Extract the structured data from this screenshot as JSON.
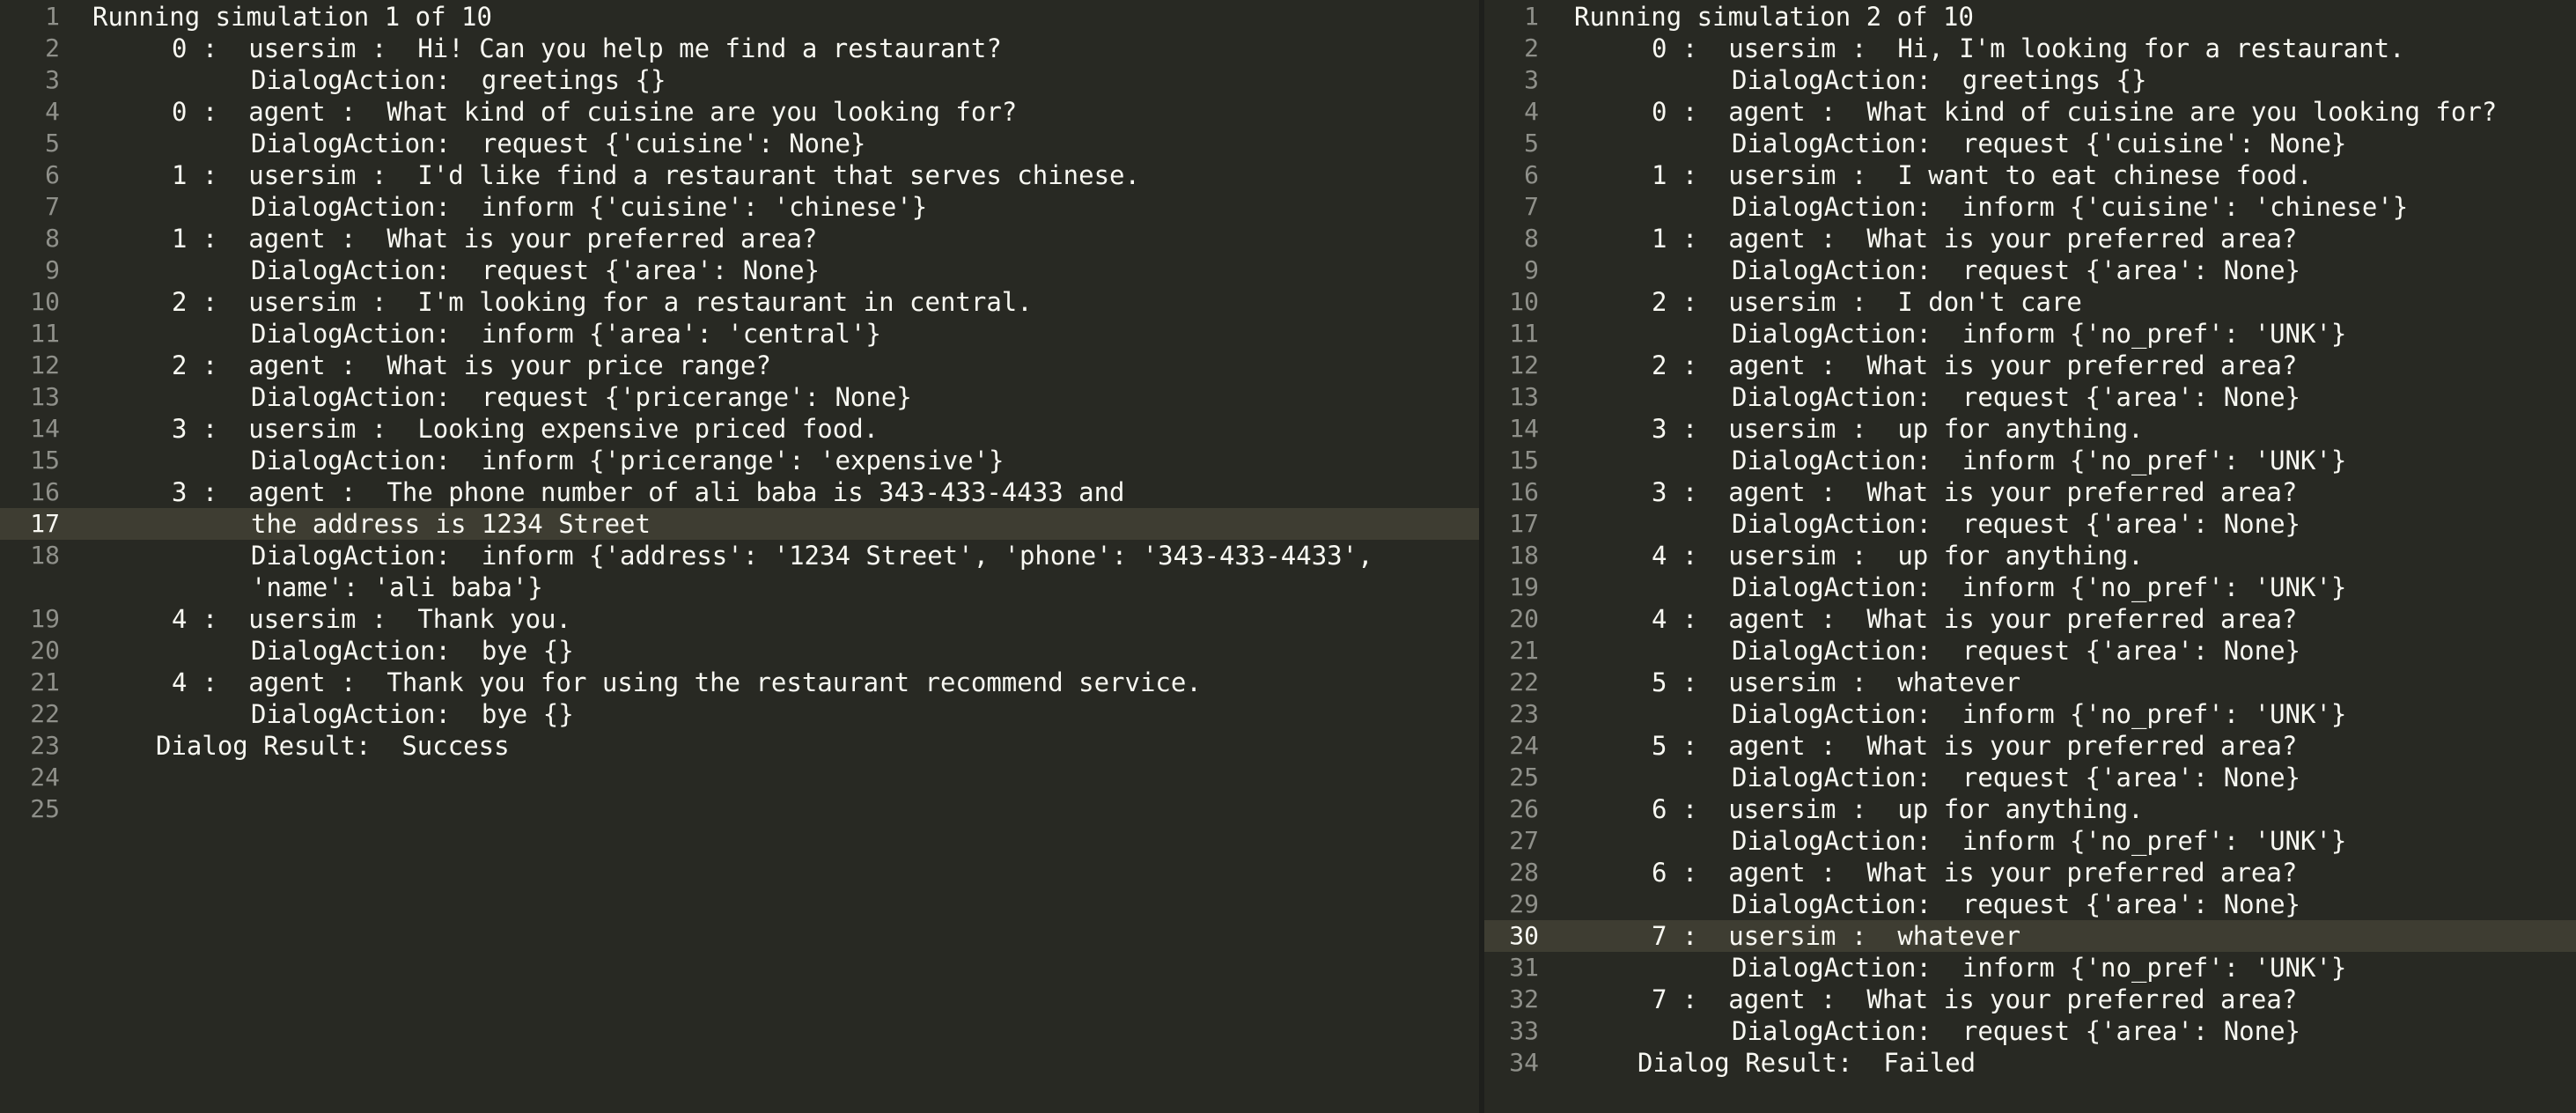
{
  "left_pane": {
    "lines": [
      {
        "num": "1",
        "text": "Running simulation 1 of 10",
        "indent": 0
      },
      {
        "num": "2",
        "text": "0 :  usersim :  Hi! Can you help me find a restaurant?",
        "indent": 1
      },
      {
        "num": "3",
        "text": "DialogAction:  greetings {}",
        "indent": 2
      },
      {
        "num": "4",
        "text": "0 :  agent :  What kind of cuisine are you looking for?",
        "indent": 1
      },
      {
        "num": "5",
        "text": "DialogAction:  request {'cuisine': None}",
        "indent": 2
      },
      {
        "num": "6",
        "text": "1 :  usersim :  I'd like find a restaurant that serves chinese.",
        "indent": 1
      },
      {
        "num": "7",
        "text": "DialogAction:  inform {'cuisine': 'chinese'}",
        "indent": 2
      },
      {
        "num": "8",
        "text": "1 :  agent :  What is your preferred area?",
        "indent": 1
      },
      {
        "num": "9",
        "text": "DialogAction:  request {'area': None}",
        "indent": 2
      },
      {
        "num": "10",
        "text": "2 :  usersim :  I'm looking for a restaurant in central.",
        "indent": 1
      },
      {
        "num": "11",
        "text": "DialogAction:  inform {'area': 'central'}",
        "indent": 2
      },
      {
        "num": "12",
        "text": "2 :  agent :  What is your price range?",
        "indent": 1
      },
      {
        "num": "13",
        "text": "DialogAction:  request {'pricerange': None}",
        "indent": 2
      },
      {
        "num": "14",
        "text": "3 :  usersim :  Looking expensive priced food.",
        "indent": 1
      },
      {
        "num": "15",
        "text": "DialogAction:  inform {'pricerange': 'expensive'}",
        "indent": 2
      },
      {
        "num": "16",
        "text": "3 :  agent :  The phone number of ali baba is 343-433-4433 and",
        "indent": 1
      },
      {
        "num": "17",
        "text": "the address is 1234 Street",
        "indent": 2,
        "current": true
      },
      {
        "num": "18",
        "text": "DialogAction:  inform {'address': '1234 Street', 'phone': '343-433-4433',",
        "indent": 2
      },
      {
        "num": "",
        "text": "'name': 'ali baba'}",
        "indent": 2
      },
      {
        "num": "19",
        "text": "4 :  usersim :  Thank you.",
        "indent": 1
      },
      {
        "num": "20",
        "text": "DialogAction:  bye {}",
        "indent": 2
      },
      {
        "num": "21",
        "text": "4 :  agent :  Thank you for using the restaurant recommend service.",
        "indent": 1
      },
      {
        "num": "22",
        "text": "DialogAction:  bye {}",
        "indent": 2
      },
      {
        "num": "23",
        "text": "Dialog Result:  Success",
        "indent": 3
      },
      {
        "num": "24",
        "text": "",
        "indent": 0
      },
      {
        "num": "25",
        "text": "",
        "indent": 0
      }
    ]
  },
  "right_pane": {
    "lines": [
      {
        "num": "1",
        "text": "Running simulation 2 of 10",
        "indent": 0
      },
      {
        "num": "2",
        "text": "0 :  usersim :  Hi, I'm looking for a restaurant.",
        "indent": 1
      },
      {
        "num": "3",
        "text": "DialogAction:  greetings {}",
        "indent": 2
      },
      {
        "num": "4",
        "text": "0 :  agent :  What kind of cuisine are you looking for?",
        "indent": 1
      },
      {
        "num": "5",
        "text": "DialogAction:  request {'cuisine': None}",
        "indent": 2
      },
      {
        "num": "6",
        "text": "1 :  usersim :  I want to eat chinese food.",
        "indent": 1
      },
      {
        "num": "7",
        "text": "DialogAction:  inform {'cuisine': 'chinese'}",
        "indent": 2
      },
      {
        "num": "8",
        "text": "1 :  agent :  What is your preferred area?",
        "indent": 1
      },
      {
        "num": "9",
        "text": "DialogAction:  request {'area': None}",
        "indent": 2
      },
      {
        "num": "10",
        "text": "2 :  usersim :  I don't care",
        "indent": 1
      },
      {
        "num": "11",
        "text": "DialogAction:  inform {'no_pref': 'UNK'}",
        "indent": 2
      },
      {
        "num": "12",
        "text": "2 :  agent :  What is your preferred area?",
        "indent": 1
      },
      {
        "num": "13",
        "text": "DialogAction:  request {'area': None}",
        "indent": 2
      },
      {
        "num": "14",
        "text": "3 :  usersim :  up for anything.",
        "indent": 1
      },
      {
        "num": "15",
        "text": "DialogAction:  inform {'no_pref': 'UNK'}",
        "indent": 2
      },
      {
        "num": "16",
        "text": "3 :  agent :  What is your preferred area?",
        "indent": 1
      },
      {
        "num": "17",
        "text": "DialogAction:  request {'area': None}",
        "indent": 2
      },
      {
        "num": "18",
        "text": "4 :  usersim :  up for anything.",
        "indent": 1
      },
      {
        "num": "19",
        "text": "DialogAction:  inform {'no_pref': 'UNK'}",
        "indent": 2
      },
      {
        "num": "20",
        "text": "4 :  agent :  What is your preferred area?",
        "indent": 1
      },
      {
        "num": "21",
        "text": "DialogAction:  request {'area': None}",
        "indent": 2
      },
      {
        "num": "22",
        "text": "5 :  usersim :  whatever",
        "indent": 1
      },
      {
        "num": "23",
        "text": "DialogAction:  inform {'no_pref': 'UNK'}",
        "indent": 2
      },
      {
        "num": "24",
        "text": "5 :  agent :  What is your preferred area?",
        "indent": 1
      },
      {
        "num": "25",
        "text": "DialogAction:  request {'area': None}",
        "indent": 2
      },
      {
        "num": "26",
        "text": "6 :  usersim :  up for anything.",
        "indent": 1
      },
      {
        "num": "27",
        "text": "DialogAction:  inform {'no_pref': 'UNK'}",
        "indent": 2
      },
      {
        "num": "28",
        "text": "6 :  agent :  What is your preferred area?",
        "indent": 1
      },
      {
        "num": "29",
        "text": "DialogAction:  request {'area': None}",
        "indent": 2
      },
      {
        "num": "30",
        "text": "7 :  usersim :  whatever",
        "indent": 1,
        "current": true
      },
      {
        "num": "31",
        "text": "DialogAction:  inform {'no_pref': 'UNK'}",
        "indent": 2
      },
      {
        "num": "32",
        "text": "7 :  agent :  What is your preferred area?",
        "indent": 1
      },
      {
        "num": "33",
        "text": "DialogAction:  request {'area': None}",
        "indent": 2
      },
      {
        "num": "34",
        "text": "Dialog Result:  Failed",
        "indent": 3
      }
    ]
  }
}
